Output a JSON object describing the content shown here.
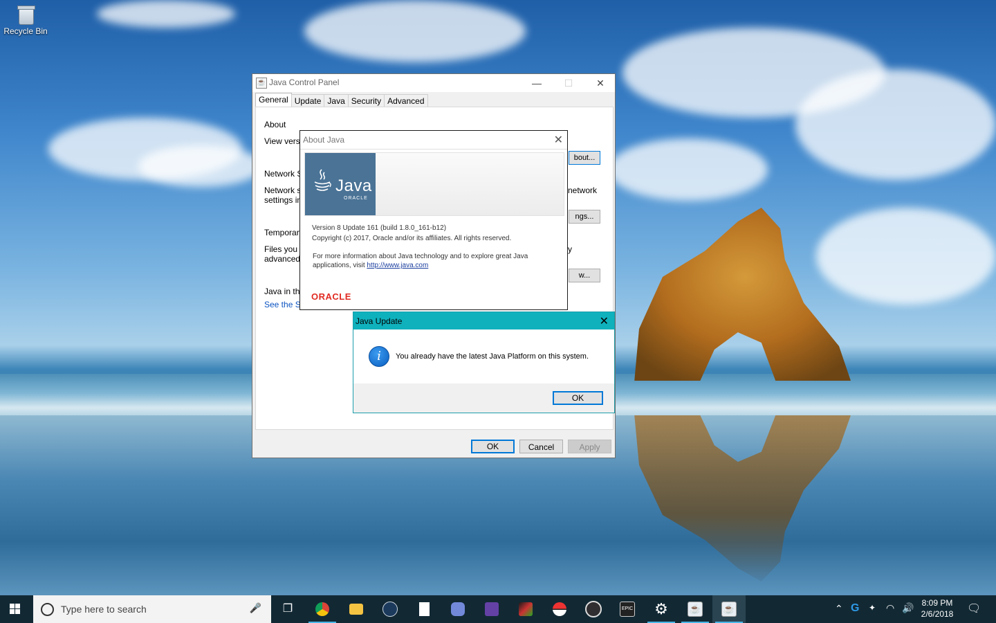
{
  "desktop": {
    "recycle_bin_label": "Recycle Bin"
  },
  "control_panel": {
    "title": "Java Control Panel",
    "tabs": [
      "General",
      "Update",
      "Java",
      "Security",
      "Advanced"
    ],
    "about_heading": "About",
    "view_version_text": "View versio",
    "about_button": "bout...",
    "network_heading": "Network Se",
    "network_text_1": "Network se",
    "network_text_2": "settings in",
    "network_text_right": "network",
    "network_button": "ngs...",
    "temp_heading": "Temporary",
    "temp_text_1": "Files you u",
    "temp_text_2": "advanced",
    "temp_text_right": "y",
    "view_button": "w...",
    "browser_heading": "Java in the",
    "browser_link": "See the Se",
    "ok_label": "OK",
    "cancel_label": "Cancel",
    "apply_label": "Apply"
  },
  "about_java": {
    "title": "About Java",
    "logo_word": "Java",
    "logo_sub": "ORACLE",
    "version_line": "Version 8 Update 161    (build 1.8.0_161-b12)",
    "copyright_line": "Copyright (c) 2017, Oracle and/or its affiliates. All rights reserved.",
    "info_line_1": "For more information about Java technology and to explore great Java",
    "info_line_2_prefix": "applications, visit ",
    "info_link": "http://www.java.com",
    "oracle_wordmark": "ORACLE"
  },
  "java_update": {
    "title": "Java Update",
    "message": "You already have the latest Java Platform on this system.",
    "ok_label": "OK",
    "icon": "info-icon"
  },
  "taskbar": {
    "search_placeholder": "Type here to search",
    "epic_label": "EPIC",
    "time": "8:09 PM",
    "date": "2/6/2018",
    "icons": [
      "windows-start",
      "cortana",
      "microphone",
      "task-view",
      "chrome",
      "file-explorer",
      "steam",
      "document",
      "discord",
      "twitch",
      "stock-chart",
      "pokeball",
      "obs",
      "epic-games",
      "settings",
      "java-control-panel",
      "java-update"
    ]
  },
  "colors": {
    "taskbar": "#122934",
    "update_titlebar": "#0fb1bd",
    "java_blue": "#4a7396",
    "oracle_red": "#e02b22",
    "focus_blue": "#0078d7"
  }
}
